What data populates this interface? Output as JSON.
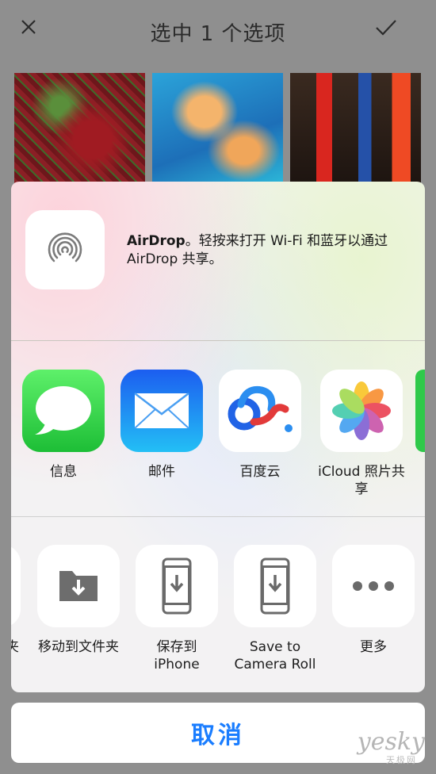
{
  "nav": {
    "title": "选中 1 个选项"
  },
  "airdrop": {
    "title": "AirDrop",
    "description": "。轻按来打开 Wi-Fi 和蓝牙以通过 AirDrop 共享。"
  },
  "apps": [
    {
      "label": "信息",
      "icon": "messages-icon"
    },
    {
      "label": "邮件",
      "icon": "mail-icon"
    },
    {
      "label": "百度云",
      "icon": "baidu-cloud-icon"
    },
    {
      "label": "iCloud 照片共享",
      "icon": "icloud-photos-icon"
    }
  ],
  "actions": [
    {
      "label": "夹",
      "icon": "folder-icon"
    },
    {
      "label": "移动到文件夹",
      "icon": "move-to-folder-icon"
    },
    {
      "label": "保存到 iPhone",
      "icon": "save-to-iphone-icon"
    },
    {
      "label": "Save to Camera Roll",
      "icon": "save-to-camera-roll-icon"
    },
    {
      "label": "更多",
      "icon": "more-icon"
    }
  ],
  "cancel_label": "取消",
  "watermark": {
    "text": "yesky",
    "sub": "天极网"
  },
  "colors": {
    "accent": "#1a7dff",
    "messages_green": "#34c759",
    "mail_blue": "#1e8cf4"
  }
}
